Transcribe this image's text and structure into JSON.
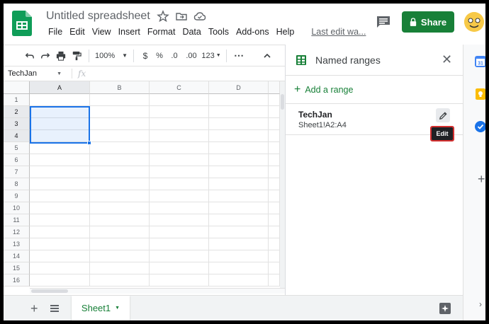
{
  "app": {
    "doc_title": "Untitled spreadsheet"
  },
  "menu": [
    "File",
    "Edit",
    "View",
    "Insert",
    "Format",
    "Data",
    "Tools",
    "Add-ons",
    "Help"
  ],
  "last_edit": "Last edit wa...",
  "share": {
    "label": "Share",
    "color": "#188038"
  },
  "toolbar": {
    "zoom": "100%",
    "currency": "$",
    "percent": "%",
    "dec_decrease": ".0",
    "dec_increase": ".00",
    "more_formats": "123"
  },
  "formula_bar": {
    "name_box": "TechJan",
    "fx": "fx",
    "value": ""
  },
  "grid": {
    "columns": [
      "A",
      "B",
      "C",
      "D"
    ],
    "rows": [
      "1",
      "2",
      "3",
      "4",
      "5",
      "6",
      "7",
      "8",
      "9",
      "10",
      "11",
      "12",
      "13",
      "14",
      "15",
      "16"
    ],
    "selected_range": "A2:A4"
  },
  "sheet_tabs": [
    {
      "label": "Sheet1",
      "active": true
    }
  ],
  "panel": {
    "title": "Named ranges",
    "add_label": "Add a range",
    "ranges": [
      {
        "name": "TechJan",
        "ref": "Sheet1!A2:A4"
      }
    ],
    "edit_tooltip": "Edit"
  },
  "colors": {
    "accent_green": "#188038",
    "selection_blue": "#1a73e8",
    "highlight_red": "#d32f2f"
  }
}
